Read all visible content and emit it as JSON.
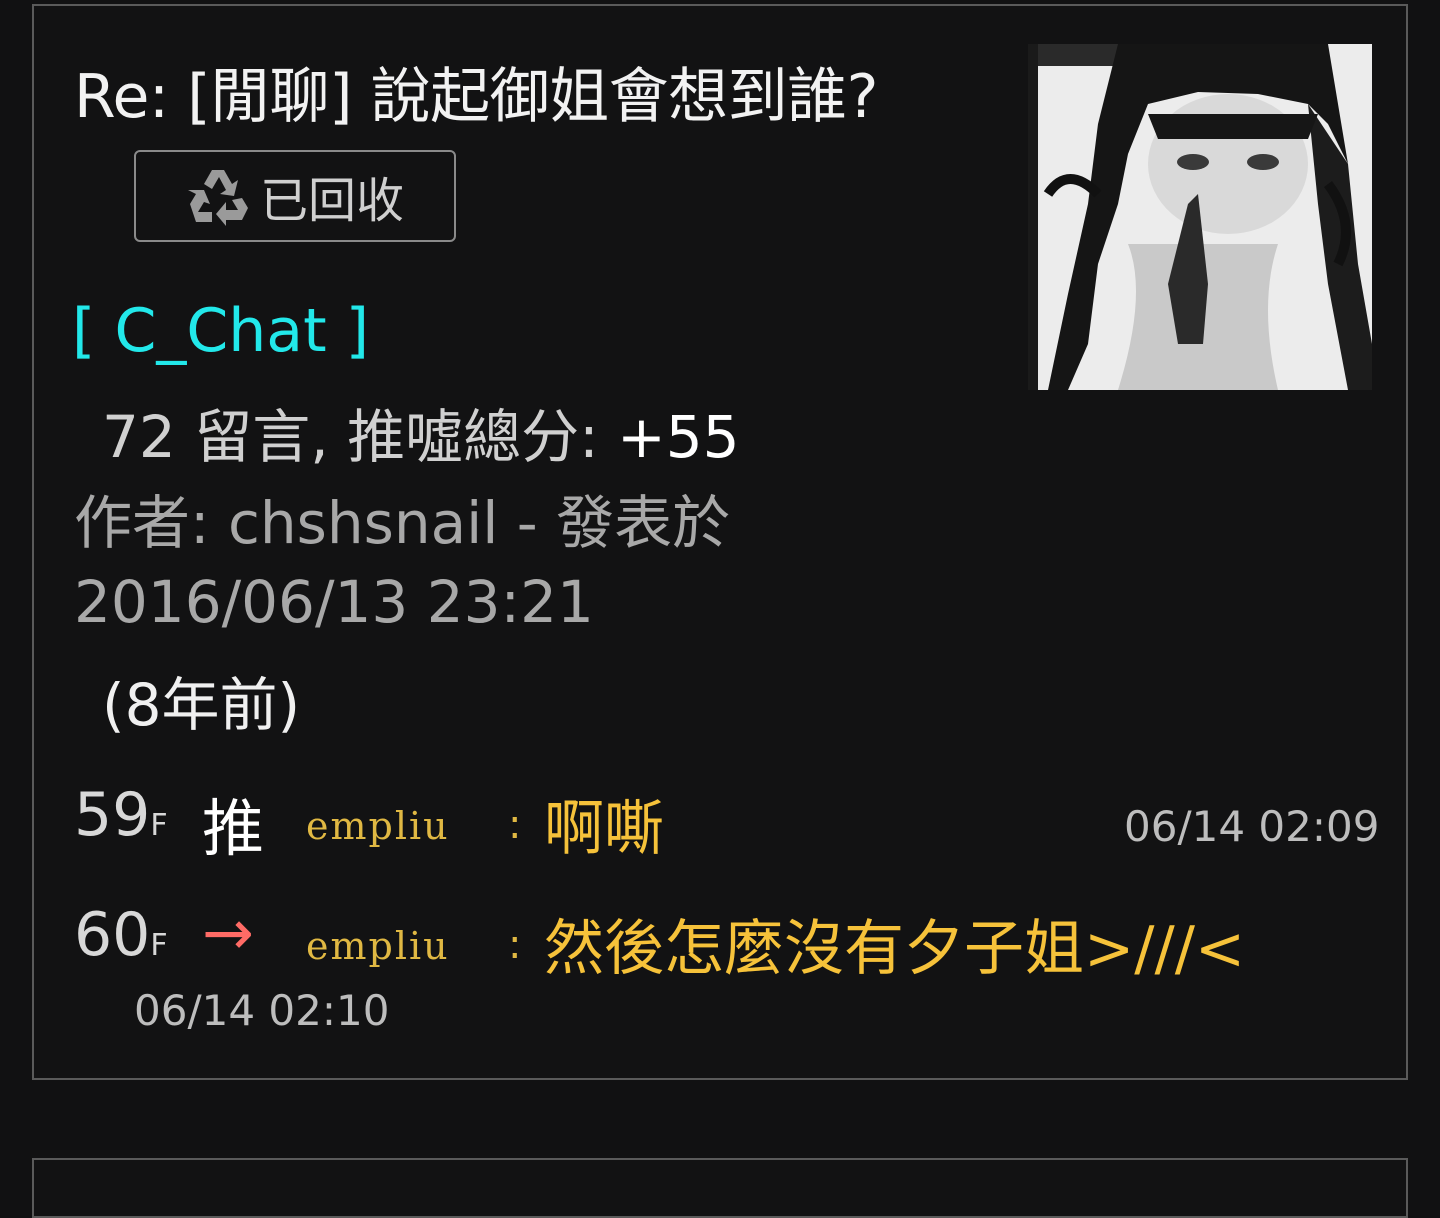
{
  "post": {
    "title": "Re: [閒聊] 說起御姐會想到誰?",
    "status_badge": "已回收",
    "status_icon": "recycle-icon",
    "board": "[ C_Chat ]",
    "comment_count": "72",
    "stats_label": "留言, 推噓總分:",
    "score": "+55",
    "author_line": "作者: chshsnail - 發表於",
    "date": "2016/06/13 23:21",
    "relative_time": "(8年前)"
  },
  "comments": [
    {
      "floor": "59",
      "floor_suffix": "F",
      "tag": "推",
      "tag_color": "#ffffff",
      "user": "empliu",
      "sep": ":",
      "text": "啊嘶",
      "time": "06/14 02:09"
    },
    {
      "floor": "60",
      "floor_suffix": "F",
      "tag": "→",
      "tag_color": "#ff6b66",
      "user": "empliu",
      "sep": ":",
      "text": "然後怎麼沒有夕子姐>///<",
      "time": "06/14 02:10"
    }
  ],
  "colors": {
    "background": "#111112",
    "board": "#22e8ea",
    "username": "#e0b843",
    "comment_text": "#f6c23a",
    "arrow": "#ff6b66"
  }
}
